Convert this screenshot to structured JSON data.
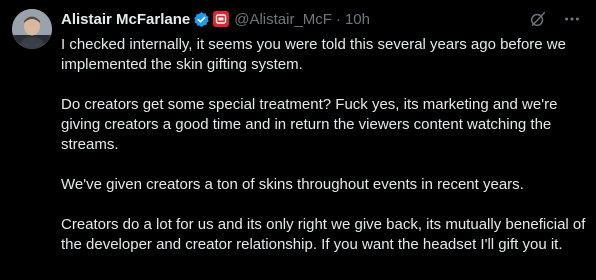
{
  "tweet": {
    "author": {
      "display_name": "Alistair McFarlane",
      "handle": "@Alistair_McF",
      "verified": true,
      "affiliation_icon": "affiliation-badge-icon"
    },
    "separator": "·",
    "timestamp": "10h",
    "icons": {
      "grok": "grok-icon",
      "more": "more-icon"
    },
    "paragraphs": [
      "I checked internally, it seems you were told this several years ago before we implemented the skin gifting system.",
      "Do creators get some special treatment? Fuck yes, its marketing and we're giving creators a good time and in return the viewers content watching the streams.",
      "We've given creators a ton of skins throughout events in recent years.",
      "Creators do a lot for us and its only right we give back, its mutually beneficial of the developer and creator relationship. If you want the headset I'll gift you it."
    ]
  },
  "colors": {
    "background": "#000000",
    "text": "#e7e9ea",
    "muted": "#71767b",
    "verified_blue": "#1d9bf0",
    "affiliation_red": "#e0252e"
  }
}
